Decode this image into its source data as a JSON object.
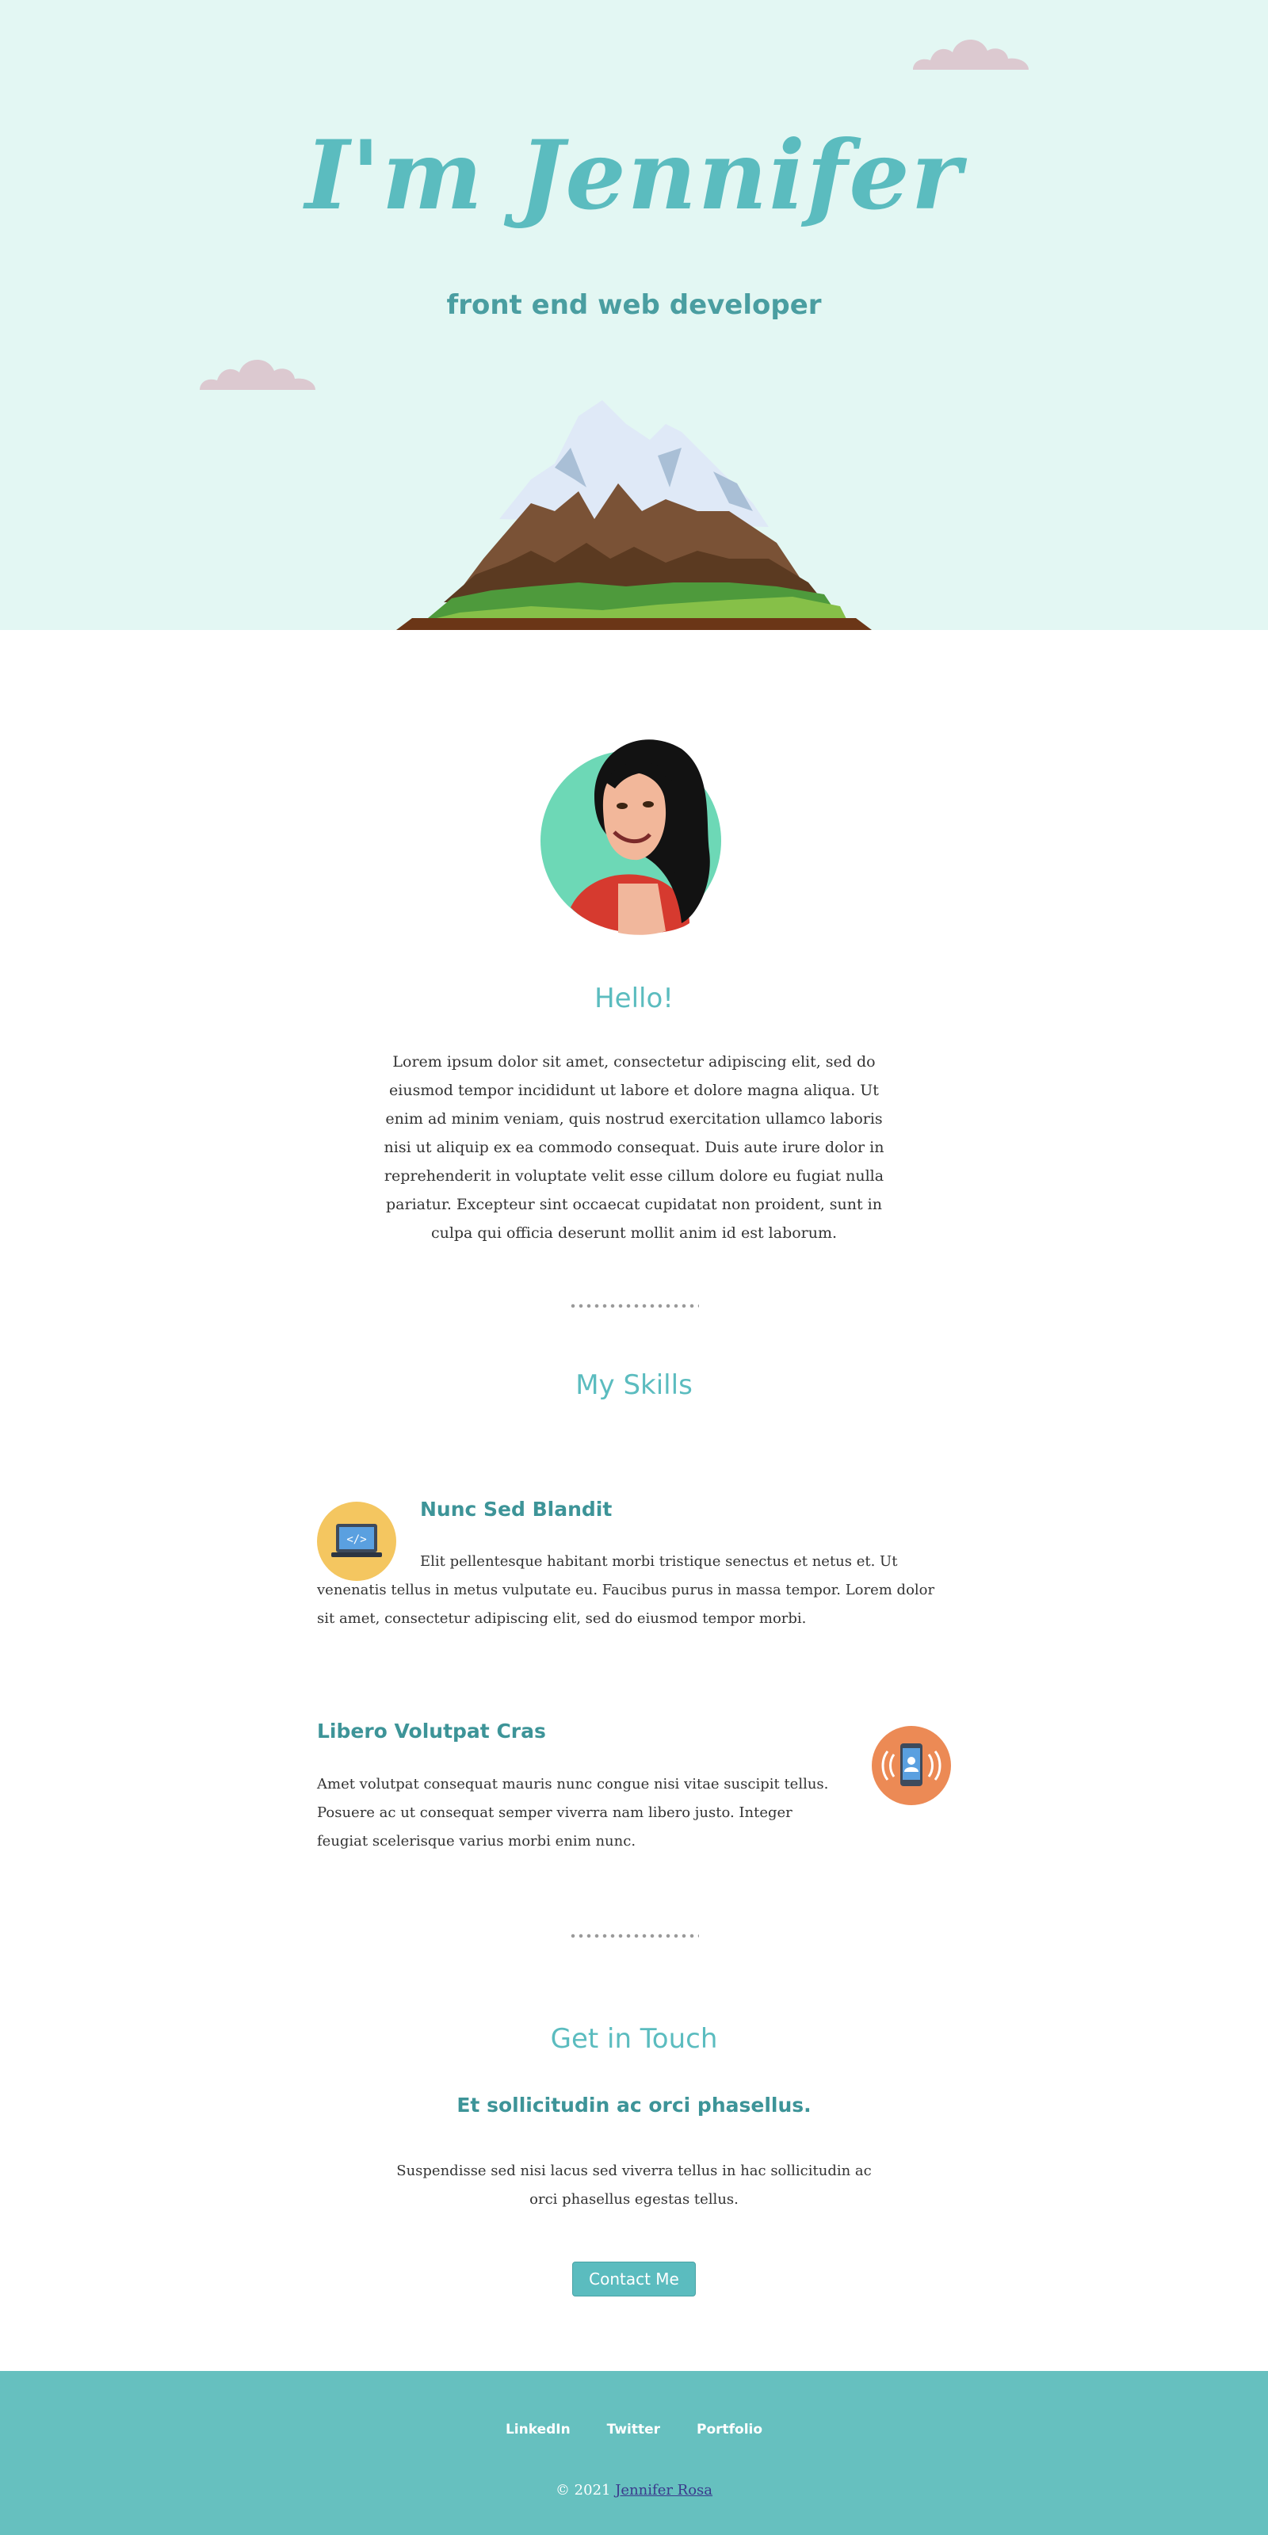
{
  "hero": {
    "title": "I'm Jennifer",
    "subtitle": "front end web developer"
  },
  "about": {
    "heading": "Hello!",
    "text": "Lorem ipsum dolor sit amet, consectetur adipiscing elit, sed do eiusmod tempor incididunt ut labore et dolore magna aliqua. Ut enim ad minim veniam, quis nostrud exercitation ullamco laboris nisi ut aliquip ex ea commodo consequat. Duis aute irure dolor in reprehenderit in voluptate velit esse cillum dolore eu fugiat nulla pariatur. Excepteur sint occaecat cupidatat non proident, sunt in culpa qui officia deserunt mollit anim id est laborum."
  },
  "skills": {
    "heading": "My Skills",
    "items": [
      {
        "title": "Nunc Sed Blandit",
        "text": "Elit pellentesque habitant morbi tristique senectus et netus et. Ut venenatis tellus in metus vulputate eu. Faucibus purus in massa tempor. Lorem dolor sit amet, consectetur adipiscing elit, sed do eiusmod tempor morbi.",
        "icon": "laptop-code-icon"
      },
      {
        "title": "Libero Volutpat Cras",
        "text": "Amet volutpat consequat mauris nunc congue nisi vitae suscipit tellus. Posuere ac ut consequat semper viverra nam libero justo. Integer feugiat scelerisque varius morbi enim nunc.",
        "icon": "mobile-phone-icon"
      }
    ]
  },
  "contact": {
    "heading": "Get in Touch",
    "subheading": "Et sollicitudin ac orci phasellus.",
    "text": "Suspendisse sed nisi lacus sed viverra tellus in hac sollicitudin ac orci phasellus egestas tellus.",
    "button": "Contact Me"
  },
  "footer": {
    "links": [
      "LinkedIn",
      "Twitter",
      "Portfolio"
    ],
    "copyright": "© 2021",
    "author": "Jennifer Rosa"
  },
  "colors": {
    "hero_bg": "#e3f7f3",
    "accent": "#5bbcbf",
    "footer_bg": "#66c0bf"
  }
}
